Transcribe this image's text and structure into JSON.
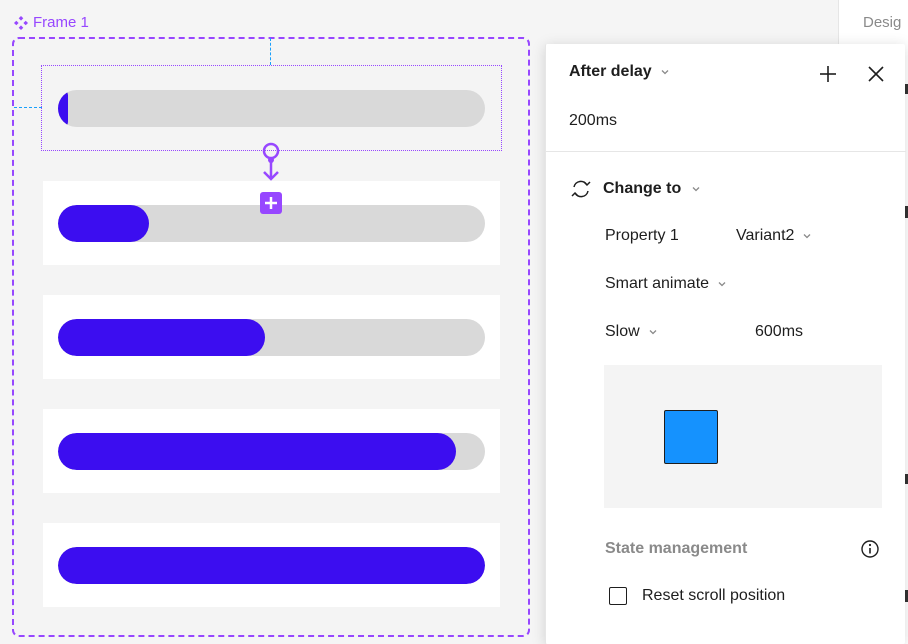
{
  "canvas": {
    "frame_name": "Frame 1",
    "progress_fractions": [
      0.02,
      0.2,
      0.48,
      0.93,
      1.0
    ]
  },
  "sidebar": {
    "tab_label": "Desig"
  },
  "popover": {
    "trigger": "After delay",
    "delay_value": "200ms",
    "action": "Change to",
    "property_name": "Property 1",
    "property_value": "Variant2",
    "animation": "Smart animate",
    "easing": "Slow",
    "duration": "600ms",
    "state_management_label": "State management",
    "reset_scroll_label": "Reset scroll position",
    "reset_scroll_checked": false
  },
  "colors": {
    "accent_purple": "#9747ff",
    "progress_fill": "#3c0df0",
    "preview_box": "#1592fe"
  },
  "icons": [
    "component-icon",
    "chevron-down-icon",
    "plus-icon",
    "close-icon",
    "swap-icon",
    "info-icon",
    "connector-add-icon"
  ]
}
